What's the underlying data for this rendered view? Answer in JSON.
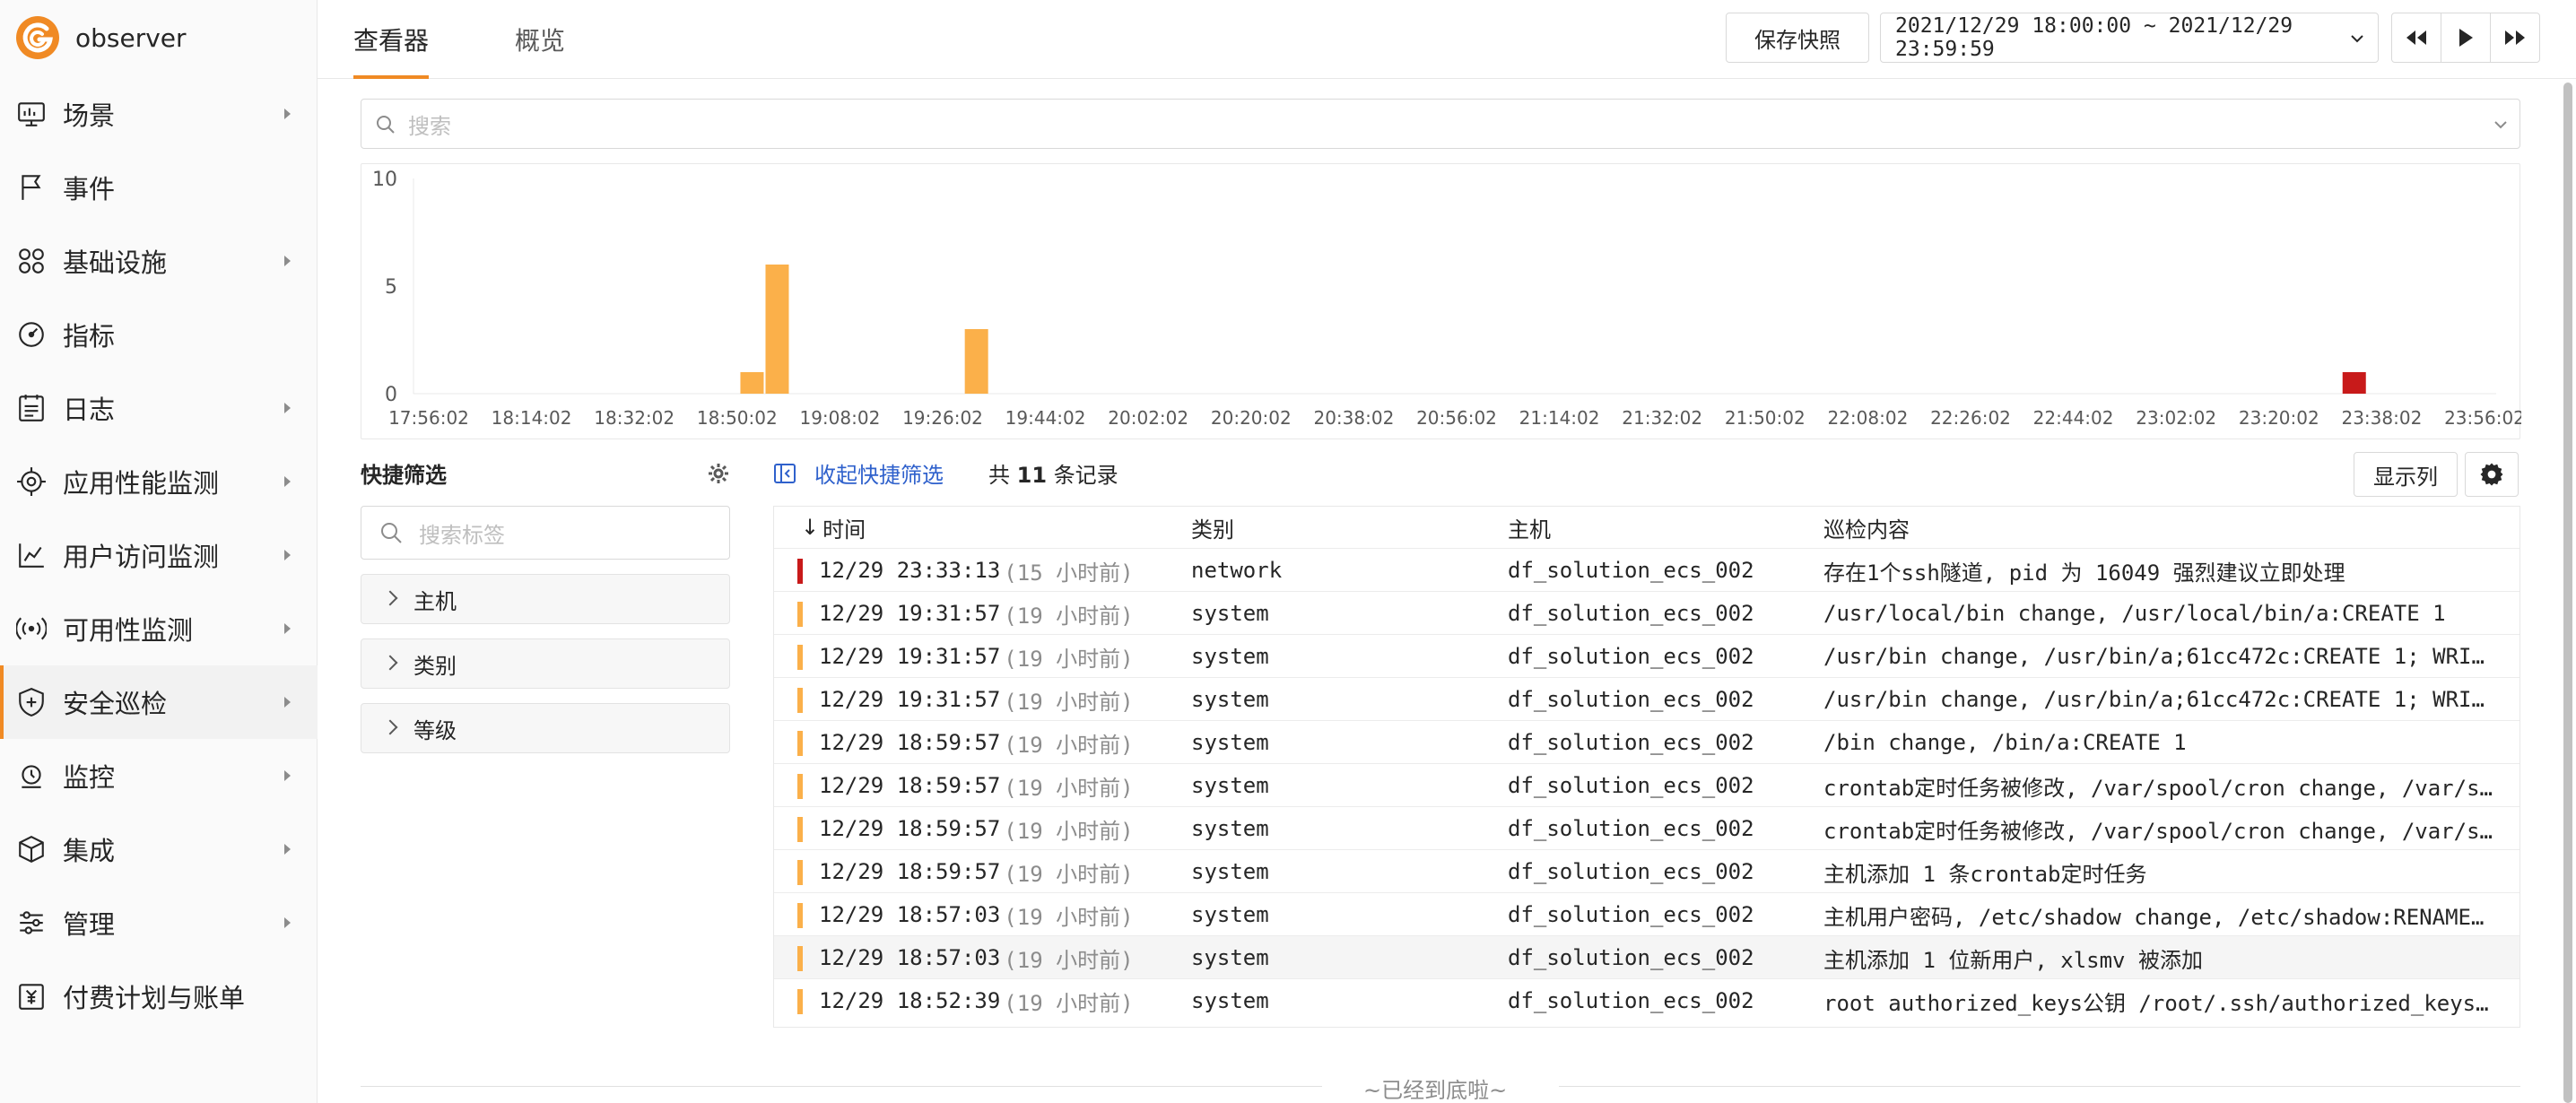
{
  "app": {
    "name": "observer"
  },
  "sidebar": {
    "items": [
      {
        "label": "场景",
        "icon": "monitor-icon",
        "arrow": true
      },
      {
        "label": "事件",
        "icon": "flag-icon",
        "arrow": false
      },
      {
        "label": "基础设施",
        "icon": "grid-circles-icon",
        "arrow": true
      },
      {
        "label": "指标",
        "icon": "gauge-icon",
        "arrow": false
      },
      {
        "label": "日志",
        "icon": "log-list-icon",
        "arrow": true
      },
      {
        "label": "应用性能监测",
        "icon": "target-icon",
        "arrow": true
      },
      {
        "label": "用户访问监测",
        "icon": "trend-chart-icon",
        "arrow": true
      },
      {
        "label": "可用性监测",
        "icon": "broadcast-icon",
        "arrow": true
      },
      {
        "label": "安全巡检",
        "icon": "shield-icon",
        "arrow": true,
        "active": true
      },
      {
        "label": "监控",
        "icon": "alarm-icon",
        "arrow": true
      },
      {
        "label": "集成",
        "icon": "cube-icon",
        "arrow": true
      },
      {
        "label": "管理",
        "icon": "sliders-icon",
        "arrow": true
      },
      {
        "label": "付费计划与账单",
        "icon": "billing-icon",
        "arrow": false
      }
    ]
  },
  "header": {
    "tabs": [
      {
        "label": "查看器",
        "active": true
      },
      {
        "label": "概览",
        "active": false
      }
    ],
    "save_snapshot": "保存快照",
    "time_range": "2021/12/29 18:00:00 ~ 2021/12/29 23:59:59"
  },
  "search": {
    "placeholder": "搜索"
  },
  "chart_data": {
    "type": "bar",
    "y_ticks": [
      "10",
      "5",
      "0"
    ],
    "ylim": [
      0,
      10
    ],
    "x_tick_labels": [
      "17:56:02",
      "18:14:02",
      "18:32:02",
      "18:50:02",
      "19:08:02",
      "19:26:02",
      "19:44:02",
      "20:02:02",
      "20:20:02",
      "20:38:02",
      "20:56:02",
      "21:14:02",
      "21:32:02",
      "21:50:02",
      "22:08:02",
      "22:26:02",
      "22:44:02",
      "23:02:02",
      "23:20:02",
      "23:38:02",
      "23:56:02"
    ],
    "bars": [
      {
        "time": "18:52:39",
        "value": 1,
        "color": "#fbb04a"
      },
      {
        "time": "18:57:03",
        "value": 6,
        "color": "#fbb04a"
      },
      {
        "time": "19:31:57",
        "value": 3,
        "color": "#fbb04a"
      },
      {
        "time": "23:33:13",
        "value": 1,
        "color": "#c81a1a"
      }
    ]
  },
  "quick_filter": {
    "title": "快捷筛选",
    "search_placeholder": "搜索标签",
    "groups": [
      "主机",
      "类别",
      "等级"
    ]
  },
  "toolbar": {
    "collapse_label": "收起快捷筛选",
    "count_prefix": "共",
    "count": "11",
    "count_suffix": "条记录",
    "columns_button": "显示列"
  },
  "table": {
    "headers": [
      "时间",
      "类别",
      "主机",
      "巡检内容"
    ],
    "sort_arrow": "↓",
    "rows": [
      {
        "level_color": "#c81a1a",
        "time": "12/29 23:33:13",
        "ago": "(15 小时前)",
        "category": "network",
        "host": "df_solution_ecs_002",
        "content": "存在1个ssh隧道, pid 为 16049 强烈建议立即处理"
      },
      {
        "level_color": "#fbb04a",
        "time": "12/29 19:31:57",
        "ago": "(19 小时前)",
        "category": "system",
        "host": "df_solution_ecs_002",
        "content": "/usr/local/bin change, /usr/local/bin/a:CREATE 1"
      },
      {
        "level_color": "#fbb04a",
        "time": "12/29 19:31:57",
        "ago": "(19 小时前)",
        "category": "system",
        "host": "df_solution_ecs_002",
        "content": "/usr/bin change, /usr/bin/a;61cc472c:CREATE 1; WRI…"
      },
      {
        "level_color": "#fbb04a",
        "time": "12/29 19:31:57",
        "ago": "(19 小时前)",
        "category": "system",
        "host": "df_solution_ecs_002",
        "content": "/usr/bin change, /usr/bin/a;61cc472c:CREATE 1; WRI…"
      },
      {
        "level_color": "#fbb04a",
        "time": "12/29 18:59:57",
        "ago": "(19 小时前)",
        "category": "system",
        "host": "df_solution_ecs_002",
        "content": "/bin change, /bin/a:CREATE 1"
      },
      {
        "level_color": "#fbb04a",
        "time": "12/29 18:59:57",
        "ago": "(19 小时前)",
        "category": "system",
        "host": "df_solution_ecs_002",
        "content": "crontab定时任务被修改, /var/spool/cron change, /var/s…"
      },
      {
        "level_color": "#fbb04a",
        "time": "12/29 18:59:57",
        "ago": "(19 小时前)",
        "category": "system",
        "host": "df_solution_ecs_002",
        "content": "crontab定时任务被修改, /var/spool/cron change, /var/s…"
      },
      {
        "level_color": "#fbb04a",
        "time": "12/29 18:59:57",
        "ago": "(19 小时前)",
        "category": "system",
        "host": "df_solution_ecs_002",
        "content": "主机添加 1 条crontab定时任务"
      },
      {
        "level_color": "#fbb04a",
        "time": "12/29 18:57:03",
        "ago": "(19 小时前)",
        "category": "system",
        "host": "df_solution_ecs_002",
        "content": "主机用户密码,  /etc/shadow change, /etc/shadow:RENAME…"
      },
      {
        "level_color": "#fbb04a",
        "time": "12/29 18:57:03",
        "ago": "(19 小时前)",
        "category": "system",
        "host": "df_solution_ecs_002",
        "content": "主机添加 1 位新用户,  xlsmv 被添加",
        "highlight": true
      },
      {
        "level_color": "#fbb04a",
        "time": "12/29 18:52:39",
        "ago": "(19 小时前)",
        "category": "system",
        "host": "df_solution_ecs_002",
        "content": "root authorized_keys公钥 /root/.ssh/authorized_keys…"
      }
    ]
  },
  "footer": {
    "end_text": "~已经到底啦~"
  },
  "colors": {
    "accent": "#f08a24",
    "warning": "#fbb04a",
    "critical": "#c81a1a",
    "link": "#2f61cc"
  }
}
